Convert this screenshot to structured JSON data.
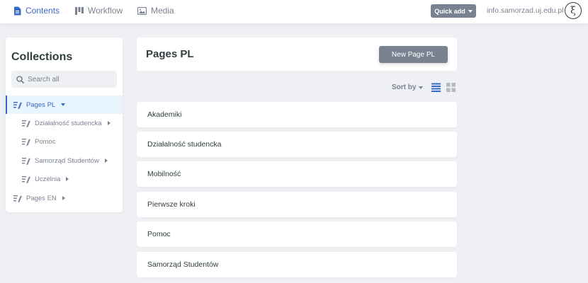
{
  "topbar": {
    "nav": [
      {
        "label": "Contents",
        "icon": "document-icon",
        "active": true
      },
      {
        "label": "Workflow",
        "icon": "workflow-icon",
        "active": false
      },
      {
        "label": "Media",
        "icon": "image-icon",
        "active": false
      }
    ],
    "quick_add_label": "Quick add",
    "site_link": "info.samorzad.uj.edu.pl",
    "avatar_glyph": "ξ"
  },
  "sidebar": {
    "title": "Collections",
    "search_placeholder": "Search all",
    "items": [
      {
        "label": "Pages PL",
        "level": 0,
        "active": true,
        "expanded": true
      },
      {
        "label": "Działalność studencka",
        "level": 1,
        "has_children": true
      },
      {
        "label": "Pomoc",
        "level": 1,
        "has_children": false
      },
      {
        "label": "Samorząd Studentów",
        "level": 1,
        "has_children": true
      },
      {
        "label": "Uczelnia",
        "level": 1,
        "has_children": true
      },
      {
        "label": "Pages EN",
        "level": 0,
        "has_children": true
      }
    ]
  },
  "main": {
    "title": "Pages PL",
    "new_button_label": "New Page PL",
    "sort_label": "Sort by",
    "entries": [
      "Akademiki",
      "Działalność studencka",
      "Mobilność",
      "Pierwsze kroki",
      "Pomoc",
      "Samorząd Studentów"
    ]
  },
  "colors": {
    "accent": "#3a69c7",
    "background": "#eff0f4",
    "button": "#798291",
    "text": "#313d3e",
    "muted": "#7a8291"
  }
}
